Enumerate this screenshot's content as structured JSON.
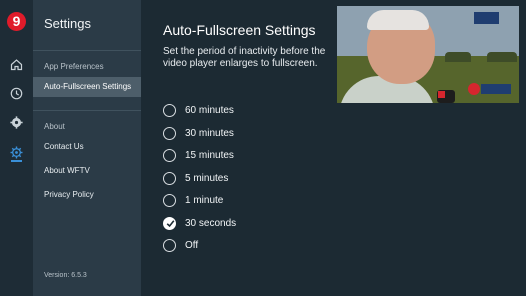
{
  "rail": {
    "logo": "9",
    "icons": [
      "home-icon",
      "clock-icon",
      "settings-gear-icon",
      "settings-cog-icon"
    ]
  },
  "sidebar": {
    "title": "Settings",
    "section_app": "App Preferences",
    "items_app": [
      {
        "label": "Auto-Fullscreen Settings",
        "active": true
      }
    ],
    "section_about": "About",
    "items_about": [
      {
        "label": "Contact Us"
      },
      {
        "label": "About WFTV"
      },
      {
        "label": "Privacy Policy"
      }
    ],
    "version": "Version: 6.5.3"
  },
  "main": {
    "title": "Auto-Fullscreen Settings",
    "description": "Set the period of inactivity before the video player enlarges to fullscreen.",
    "options": [
      {
        "label": "60 minutes",
        "selected": false
      },
      {
        "label": "30 minutes",
        "selected": false
      },
      {
        "label": "15 minutes",
        "selected": false
      },
      {
        "label": "5 minutes",
        "selected": false
      },
      {
        "label": "1 minute",
        "selected": false
      },
      {
        "label": "30 seconds",
        "selected": true
      },
      {
        "label": "Off",
        "selected": false
      }
    ]
  },
  "colors": {
    "accent": "#3a90d8",
    "brand_red": "#e01b2a",
    "background": "#1c2a33",
    "sidebar": "#2b3b47"
  }
}
